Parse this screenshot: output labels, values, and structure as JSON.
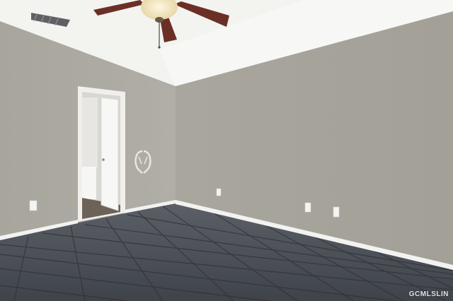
{
  "image": {
    "subject": "empty-bedroom-interior",
    "colors": {
      "ceiling": "#f4f4f1",
      "left_wall": "#aaa89f",
      "right_wall": "#a6a39b",
      "floor": "#4a4e55",
      "grout": "#2f3237",
      "baseboard": "#f2f2f0",
      "door_trim": "#f0efec",
      "fan_blade": "#6b2f25",
      "fan_light": "#f3e3b6"
    },
    "objects": [
      "ceiling-fan-with-light",
      "air-vent",
      "open-door-to-bathroom",
      "decorative-wing-wall-art",
      "electrical-outlets",
      "tiled-floor"
    ]
  },
  "watermark": {
    "text": "GCMLSLIN"
  }
}
